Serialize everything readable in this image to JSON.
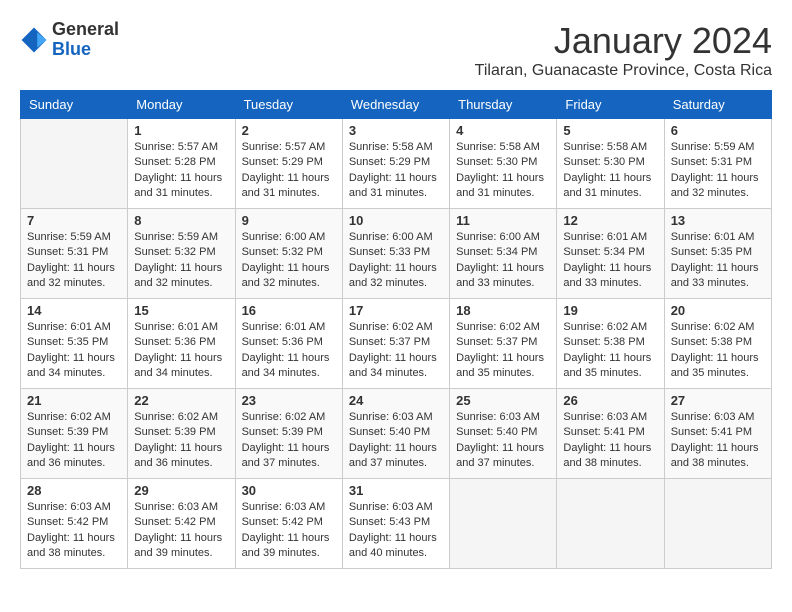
{
  "logo": {
    "general": "General",
    "blue": "Blue"
  },
  "title": "January 2024",
  "subtitle": "Tilaran, Guanacaste Province, Costa Rica",
  "weekdays": [
    "Sunday",
    "Monday",
    "Tuesday",
    "Wednesday",
    "Thursday",
    "Friday",
    "Saturday"
  ],
  "weeks": [
    [
      {
        "num": "",
        "empty": true
      },
      {
        "num": "1",
        "rise": "5:57 AM",
        "set": "5:28 PM",
        "daylight": "11 hours and 31 minutes."
      },
      {
        "num": "2",
        "rise": "5:57 AM",
        "set": "5:29 PM",
        "daylight": "11 hours and 31 minutes."
      },
      {
        "num": "3",
        "rise": "5:58 AM",
        "set": "5:29 PM",
        "daylight": "11 hours and 31 minutes."
      },
      {
        "num": "4",
        "rise": "5:58 AM",
        "set": "5:30 PM",
        "daylight": "11 hours and 31 minutes."
      },
      {
        "num": "5",
        "rise": "5:58 AM",
        "set": "5:30 PM",
        "daylight": "11 hours and 31 minutes."
      },
      {
        "num": "6",
        "rise": "5:59 AM",
        "set": "5:31 PM",
        "daylight": "11 hours and 32 minutes."
      }
    ],
    [
      {
        "num": "7",
        "rise": "5:59 AM",
        "set": "5:31 PM",
        "daylight": "11 hours and 32 minutes."
      },
      {
        "num": "8",
        "rise": "5:59 AM",
        "set": "5:32 PM",
        "daylight": "11 hours and 32 minutes."
      },
      {
        "num": "9",
        "rise": "6:00 AM",
        "set": "5:32 PM",
        "daylight": "11 hours and 32 minutes."
      },
      {
        "num": "10",
        "rise": "6:00 AM",
        "set": "5:33 PM",
        "daylight": "11 hours and 32 minutes."
      },
      {
        "num": "11",
        "rise": "6:00 AM",
        "set": "5:34 PM",
        "daylight": "11 hours and 33 minutes."
      },
      {
        "num": "12",
        "rise": "6:01 AM",
        "set": "5:34 PM",
        "daylight": "11 hours and 33 minutes."
      },
      {
        "num": "13",
        "rise": "6:01 AM",
        "set": "5:35 PM",
        "daylight": "11 hours and 33 minutes."
      }
    ],
    [
      {
        "num": "14",
        "rise": "6:01 AM",
        "set": "5:35 PM",
        "daylight": "11 hours and 34 minutes."
      },
      {
        "num": "15",
        "rise": "6:01 AM",
        "set": "5:36 PM",
        "daylight": "11 hours and 34 minutes."
      },
      {
        "num": "16",
        "rise": "6:01 AM",
        "set": "5:36 PM",
        "daylight": "11 hours and 34 minutes."
      },
      {
        "num": "17",
        "rise": "6:02 AM",
        "set": "5:37 PM",
        "daylight": "11 hours and 34 minutes."
      },
      {
        "num": "18",
        "rise": "6:02 AM",
        "set": "5:37 PM",
        "daylight": "11 hours and 35 minutes."
      },
      {
        "num": "19",
        "rise": "6:02 AM",
        "set": "5:38 PM",
        "daylight": "11 hours and 35 minutes."
      },
      {
        "num": "20",
        "rise": "6:02 AM",
        "set": "5:38 PM",
        "daylight": "11 hours and 35 minutes."
      }
    ],
    [
      {
        "num": "21",
        "rise": "6:02 AM",
        "set": "5:39 PM",
        "daylight": "11 hours and 36 minutes."
      },
      {
        "num": "22",
        "rise": "6:02 AM",
        "set": "5:39 PM",
        "daylight": "11 hours and 36 minutes."
      },
      {
        "num": "23",
        "rise": "6:02 AM",
        "set": "5:39 PM",
        "daylight": "11 hours and 37 minutes."
      },
      {
        "num": "24",
        "rise": "6:03 AM",
        "set": "5:40 PM",
        "daylight": "11 hours and 37 minutes."
      },
      {
        "num": "25",
        "rise": "6:03 AM",
        "set": "5:40 PM",
        "daylight": "11 hours and 37 minutes."
      },
      {
        "num": "26",
        "rise": "6:03 AM",
        "set": "5:41 PM",
        "daylight": "11 hours and 38 minutes."
      },
      {
        "num": "27",
        "rise": "6:03 AM",
        "set": "5:41 PM",
        "daylight": "11 hours and 38 minutes."
      }
    ],
    [
      {
        "num": "28",
        "rise": "6:03 AM",
        "set": "5:42 PM",
        "daylight": "11 hours and 38 minutes."
      },
      {
        "num": "29",
        "rise": "6:03 AM",
        "set": "5:42 PM",
        "daylight": "11 hours and 39 minutes."
      },
      {
        "num": "30",
        "rise": "6:03 AM",
        "set": "5:42 PM",
        "daylight": "11 hours and 39 minutes."
      },
      {
        "num": "31",
        "rise": "6:03 AM",
        "set": "5:43 PM",
        "daylight": "11 hours and 40 minutes."
      },
      {
        "num": "",
        "empty": true
      },
      {
        "num": "",
        "empty": true
      },
      {
        "num": "",
        "empty": true
      }
    ]
  ]
}
